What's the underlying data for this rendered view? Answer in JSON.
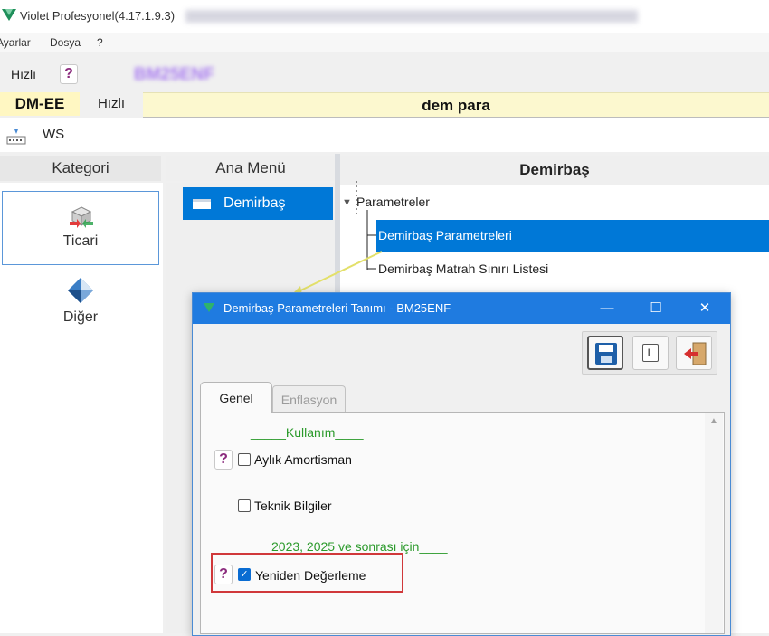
{
  "app": {
    "title": "Violet Profesyonel(4.17.1.9.3)",
    "logo_color": "#1f8f5a"
  },
  "menu": {
    "items": [
      "Ayarlar",
      "Dosya",
      "?"
    ]
  },
  "toolbar": {
    "hizli_label": "Hızlı",
    "help_label": "?",
    "blurred_code": "BM25ENF"
  },
  "company": {
    "code": "DM-EE",
    "hizli_label": "Hızlı",
    "name": "dem para"
  },
  "ws": {
    "label": "WS"
  },
  "left_panel": {
    "header": "Kategori",
    "categories": [
      {
        "label": "Ticari",
        "icon": "cube-transfer-icon"
      },
      {
        "label": "Diğer",
        "icon": "diamond-icon"
      }
    ]
  },
  "menu_col": {
    "header": "Ana Menü",
    "items": [
      {
        "label": "Demirbaş",
        "icon": "folder-icon"
      }
    ]
  },
  "right": {
    "header": "Demirbaş",
    "tree": {
      "root": "Parametreler",
      "children": [
        "Demirbaş Parametreleri",
        "Demirbaş Matrah Sınırı Listesi"
      ]
    }
  },
  "dialog": {
    "title": "Demirbaş Parametreleri Tanımı - BM25ENF",
    "win_buttons": {
      "minimize": "—",
      "maximize": "☐",
      "close": "✕"
    },
    "tool_buttons": [
      {
        "icon": "save-icon"
      },
      {
        "icon": "list-l-icon",
        "label": "L"
      },
      {
        "icon": "exit-door-icon"
      }
    ],
    "tabs": [
      "Genel",
      "Enflasyon"
    ],
    "sections": {
      "kullanim": "_____Kullanım____",
      "yil": "2023, 2025 ve sonrası için____"
    },
    "checks": {
      "aylik": {
        "label": "Aylık Amortisman",
        "checked": false
      },
      "teknik": {
        "label": "Teknik Bilgiler",
        "checked": false
      },
      "yeniden": {
        "label": "Yeniden Değerleme",
        "checked": true
      }
    },
    "help_label": "?"
  },
  "colors": {
    "accent": "#0078d7",
    "highlight_border": "#d0383a",
    "green_text": "#2b9a2b",
    "company_bar": "#fcf8cf"
  }
}
